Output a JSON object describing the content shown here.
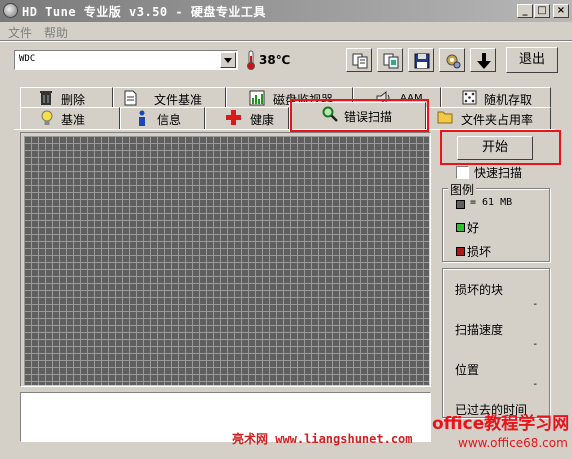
{
  "window": {
    "title": "HD Tune 专业版 v3.50 - 硬盘专业工具",
    "min_glyph": "_",
    "max_glyph": "□",
    "close_glyph": "×"
  },
  "menu": [
    "文件",
    "帮助"
  ],
  "toolbar": {
    "drive": "WDC",
    "temperature": "38℃",
    "exit_label": "退出"
  },
  "tabs_top": [
    "删除",
    "文件基准",
    "磁盘监视器",
    "AAM",
    "随机存取"
  ],
  "tabs_bottom": [
    "基准",
    "信息",
    "健康",
    "错误扫描",
    "文件夹占用率"
  ],
  "scan": {
    "start_label": "开始",
    "quick_scan_label": "快速扫描",
    "legend_title": "图例",
    "legend_block": "= 61 MB",
    "legend_good": "好",
    "legend_bad": "损坏",
    "stats": {
      "damaged_blocks": "损坏的块",
      "scan_speed": "扫描速度",
      "position": "位置",
      "elapsed": "已过去的时间",
      "placeholder": "-"
    }
  },
  "watermarks": {
    "left": "亮术网 www.liangshunet.com",
    "right_top": "office教程学习网",
    "right_bottom": "www.office68.com"
  },
  "colors": {
    "highlight": "#e8141a",
    "grid_block": "#5f5f5f",
    "good": "#2ec02e",
    "bad": "#b01818"
  }
}
